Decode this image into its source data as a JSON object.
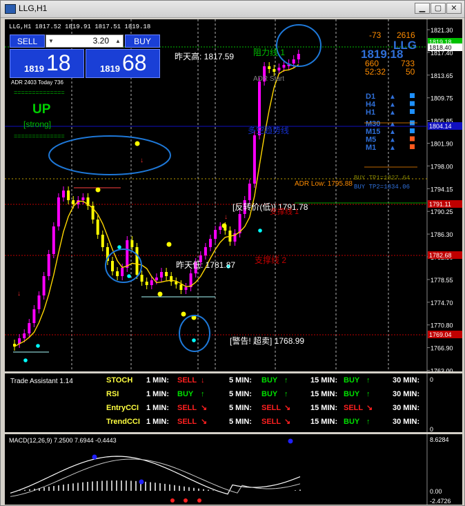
{
  "window": {
    "title": "LLG,H1"
  },
  "chart_header": {
    "text": "LLG,H1  1817.52 1819.91 1817.51 1819.18"
  },
  "trade_panel": {
    "sell_label": "SELL",
    "buy_label": "BUY",
    "lot_value": "3.20",
    "sell_small": "1819",
    "sell_big": "18",
    "buy_small": "1819",
    "buy_big": "68"
  },
  "adr_text": "ADR 2403    Today 736",
  "trend": {
    "dashes": "==============",
    "label": "UP",
    "strength": "[strong]"
  },
  "top_right": {
    "v1": "-73",
    "v2": "2616",
    "symbol": "LLG",
    "price": "1819.18",
    "v3": "660",
    "v4": "733",
    "time": "52:32",
    "v5": "50"
  },
  "timeframes": [
    {
      "tf": "D1",
      "arrow": "▲",
      "box_color": "#1e90ff"
    },
    {
      "tf": "H4",
      "arrow": "▲",
      "box_color": "#1e90ff"
    },
    {
      "tf": "H1",
      "arrow": "▲",
      "box_color": "#1e90ff"
    },
    {
      "tf": "M30",
      "arrow": "▲",
      "box_color": "#1e90ff"
    },
    {
      "tf": "M15",
      "arrow": "▲",
      "box_color": "#1e90ff"
    },
    {
      "tf": "M5",
      "arrow": "▲",
      "box_color": "#ff5a1e"
    },
    {
      "tf": "M1",
      "arrow": "▲",
      "box_color": "#ff5a1e"
    }
  ],
  "annotations": {
    "prev_high": "昨天高: 1817.59",
    "resistance1": "阻力线 1",
    "adr_start": "ADR Start",
    "trend_line": "多空趋势线",
    "buy_tp1": "BUY TP1=1827.64",
    "buy_tp2": "BUY TP2=1834.06",
    "adr_low": "ADR Low: 1795.88",
    "reversal": "[反转价(低)] 1791.78",
    "support1": "支撑线 1",
    "prev_low": "昨天低: 1781.87",
    "support2": "支撑线 2",
    "warning": "[警告! 超卖] 1768.99"
  },
  "price_axis": {
    "ticks": [
      "1821.30",
      "1817.40",
      "1813.65",
      "1809.75",
      "1805.85",
      "1801.90",
      "1798.00",
      "1794.15",
      "1790.25",
      "1786.30",
      "1782.50",
      "1778.55",
      "1774.70",
      "1770.80",
      "1766.90",
      "1763.00"
    ],
    "tags": [
      {
        "label": "1819.18",
        "color": "#00c000",
        "text_color": "#ffffff"
      },
      {
        "label": "1818.40",
        "color": "#ffffff",
        "text_color": "#000000"
      },
      {
        "label": "1804.14",
        "color": "#1010c0",
        "text_color": "#ffffff"
      },
      {
        "label": "1791.11",
        "color": "#c00000",
        "text_color": "#ffffff"
      },
      {
        "label": "1782.68",
        "color": "#c00000",
        "text_color": "#ffffff"
      },
      {
        "label": "1769.04",
        "color": "#c00000",
        "text_color": "#ffffff"
      }
    ]
  },
  "trade_assistant": {
    "title": "Trade Assistant 1.14",
    "axis_top": "0",
    "axis_bottom": "0",
    "rows": [
      {
        "name": "STOCH",
        "signals": [
          [
            "1 MIN:",
            "SELL",
            "↓"
          ],
          [
            "5 MIN:",
            "BUY",
            "↑"
          ],
          [
            "15 MIN:",
            "BUY",
            "↑"
          ],
          [
            "30 MIN:",
            "",
            ""
          ]
        ]
      },
      {
        "name": "RSI",
        "signals": [
          [
            "1 MIN:",
            "BUY",
            "↑"
          ],
          [
            "5 MIN:",
            "BUY",
            "↑"
          ],
          [
            "15 MIN:",
            "BUY",
            "↑"
          ],
          [
            "30 MIN:",
            "",
            ""
          ]
        ]
      },
      {
        "name": "EntryCCI",
        "signals": [
          [
            "1 MIN:",
            "SELL",
            "↘"
          ],
          [
            "5 MIN:",
            "SELL",
            "↘"
          ],
          [
            "15 MIN:",
            "SELL",
            "↘"
          ],
          [
            "30 MIN:",
            "",
            ""
          ]
        ]
      },
      {
        "name": "TrendCCI",
        "signals": [
          [
            "1 MIN:",
            "SELL",
            "↘"
          ],
          [
            "5 MIN:",
            "SELL",
            "↘"
          ],
          [
            "15 MIN:",
            "BUY",
            "↑"
          ],
          [
            "30 MIN:",
            "",
            ""
          ]
        ]
      }
    ]
  },
  "macd": {
    "title": "MACD(12,26,9) 7.2500 7.6944 -0.4443",
    "axis_top": "8.6284",
    "axis_zero": "0.00",
    "axis_bottom": "-2.4726"
  },
  "colors": {
    "bull": "#ff00ff",
    "bear": "#ffff00",
    "ma": "#ffd700",
    "buy": "#00e000",
    "sell": "#ff2020"
  }
}
